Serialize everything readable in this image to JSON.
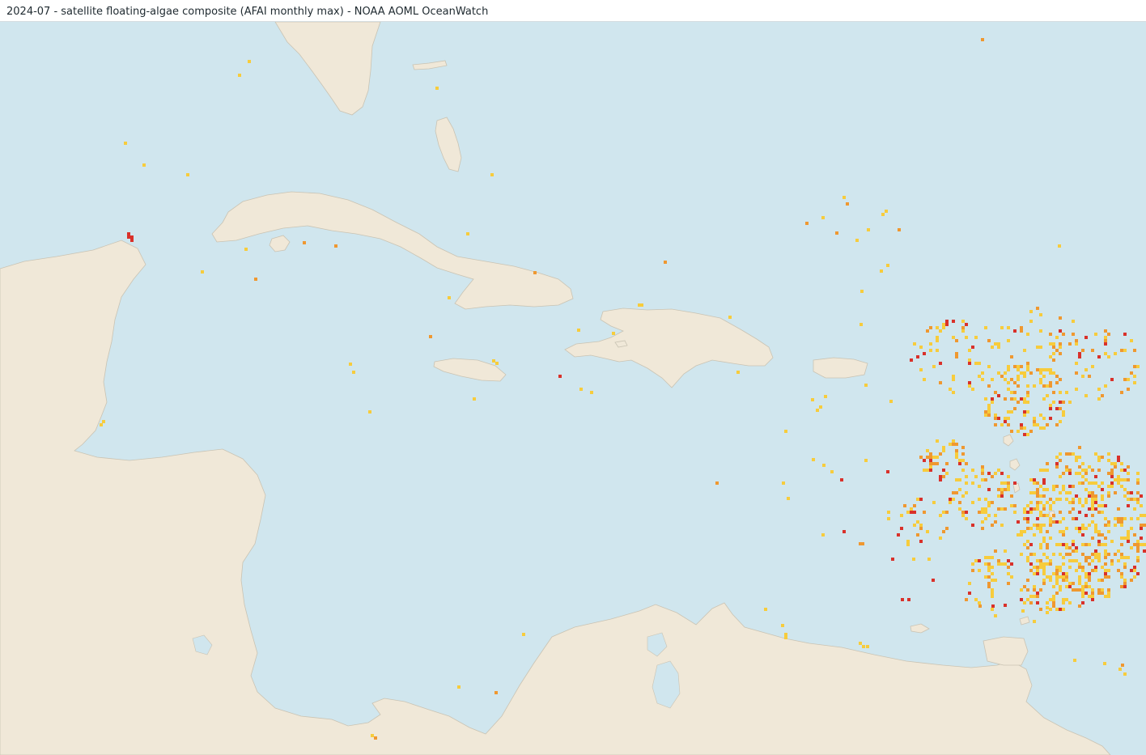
{
  "header": {
    "title": "2024-07 - satellite floating-algae composite (AFAI monthly max) - NOAA AOML OceanWatch"
  },
  "map": {
    "colors": {
      "ocean": "#d0e6ee",
      "land": "#f0e8d8",
      "coast": "#c9c3b3",
      "low": "#f7cc3c",
      "medium": "#ef9830",
      "high": "#d9312a"
    },
    "detection_levels": [
      "low",
      "medium",
      "high"
    ]
  }
}
